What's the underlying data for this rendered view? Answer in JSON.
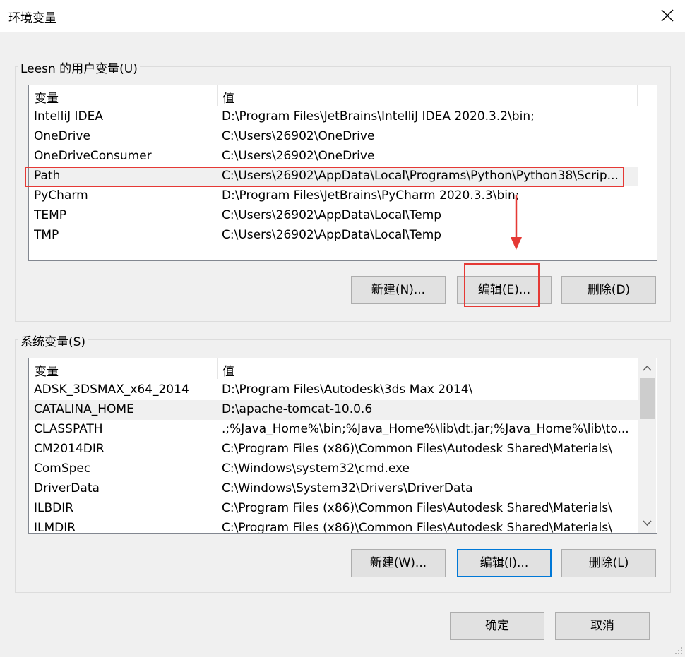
{
  "window": {
    "title": "环境变量"
  },
  "user_vars": {
    "group_label": "Leesn 的用户变量(U)",
    "columns": [
      "变量",
      "值"
    ],
    "rows": [
      {
        "name": "IntelliJ IDEA",
        "value": "D:\\Program Files\\JetBrains\\IntelliJ IDEA 2020.3.2\\bin;"
      },
      {
        "name": "OneDrive",
        "value": "C:\\Users\\26902\\OneDrive"
      },
      {
        "name": "OneDriveConsumer",
        "value": "C:\\Users\\26902\\OneDrive"
      },
      {
        "name": "Path",
        "value": "C:\\Users\\26902\\AppData\\Local\\Programs\\Python\\Python38\\Scrip..."
      },
      {
        "name": "PyCharm",
        "value": "D:\\Program Files\\JetBrains\\PyCharm 2020.3.3\\bin;"
      },
      {
        "name": "TEMP",
        "value": "C:\\Users\\26902\\AppData\\Local\\Temp"
      },
      {
        "name": "TMP",
        "value": "C:\\Users\\26902\\AppData\\Local\\Temp"
      }
    ],
    "buttons": {
      "new": "新建(N)...",
      "edit": "编辑(E)...",
      "delete": "删除(D)"
    }
  },
  "system_vars": {
    "group_label": "系统变量(S)",
    "columns": [
      "变量",
      "值"
    ],
    "rows": [
      {
        "name": "ADSK_3DSMAX_x64_2014",
        "value": "D:\\Program Files\\Autodesk\\3ds Max 2014\\"
      },
      {
        "name": "CATALINA_HOME",
        "value": "D:\\apache-tomcat-10.0.6"
      },
      {
        "name": "CLASSPATH",
        "value": ".;%Java_Home%\\bin;%Java_Home%\\lib\\dt.jar;%Java_Home%\\lib\\to..."
      },
      {
        "name": "CM2014DIR",
        "value": "C:\\Program Files (x86)\\Common Files\\Autodesk Shared\\Materials\\"
      },
      {
        "name": "ComSpec",
        "value": "C:\\Windows\\system32\\cmd.exe"
      },
      {
        "name": "DriverData",
        "value": "C:\\Windows\\System32\\Drivers\\DriverData"
      },
      {
        "name": "ILBDIR",
        "value": "C:\\Program Files (x86)\\Common Files\\Autodesk Shared\\Materials\\"
      },
      {
        "name": "ILMDIR",
        "value": "C:\\Program Files (x86)\\Common Files\\Autodesk Shared\\Materials\\"
      }
    ],
    "buttons": {
      "new": "新建(W)...",
      "edit": "编辑(I)...",
      "delete": "删除(L)"
    }
  },
  "footer": {
    "ok": "确定",
    "cancel": "取消"
  },
  "colors": {
    "highlight": "#e53935",
    "focus": "#0078d7"
  },
  "icons": [
    "close-icon",
    "scroll-up-icon",
    "scroll-down-icon",
    "arrow-down-annotation"
  ]
}
